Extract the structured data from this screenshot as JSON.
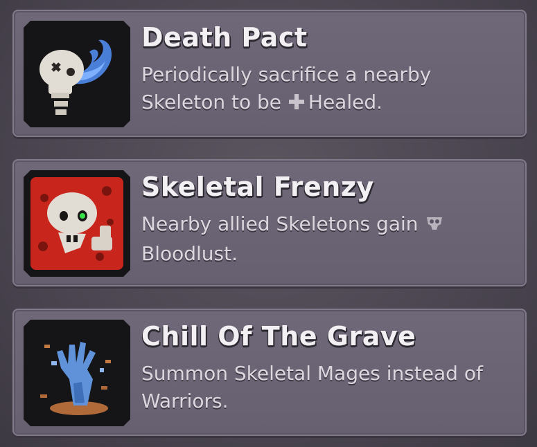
{
  "cards": [
    {
      "title": "Death Pact",
      "desc_before": "Periodically sacrifice a nearby Skeleton to be ",
      "keyword": "Healed.",
      "keyword_icon": "plus-heal-icon",
      "icon": "skull-breath-icon"
    },
    {
      "title": "Skeletal Frenzy",
      "desc_before": "Nearby allied Skeletons gain ",
      "keyword": "Bloodlust.",
      "keyword_icon": "bloodlust-skull-icon",
      "icon": "frenzied-skull-icon"
    },
    {
      "title": "Chill Of The Grave",
      "desc_before": "Summon Skeletal Mages instead of Warriors.",
      "keyword": "",
      "keyword_icon": "",
      "icon": "frozen-hand-icon"
    }
  ],
  "colors": {
    "panel": "#6e6878",
    "border": "#807a8a",
    "title_text": "#f3f0f3",
    "body_text": "#dcd7de",
    "frenzy_red": "#c8261c",
    "chill_blue": "#6a9ad6"
  }
}
